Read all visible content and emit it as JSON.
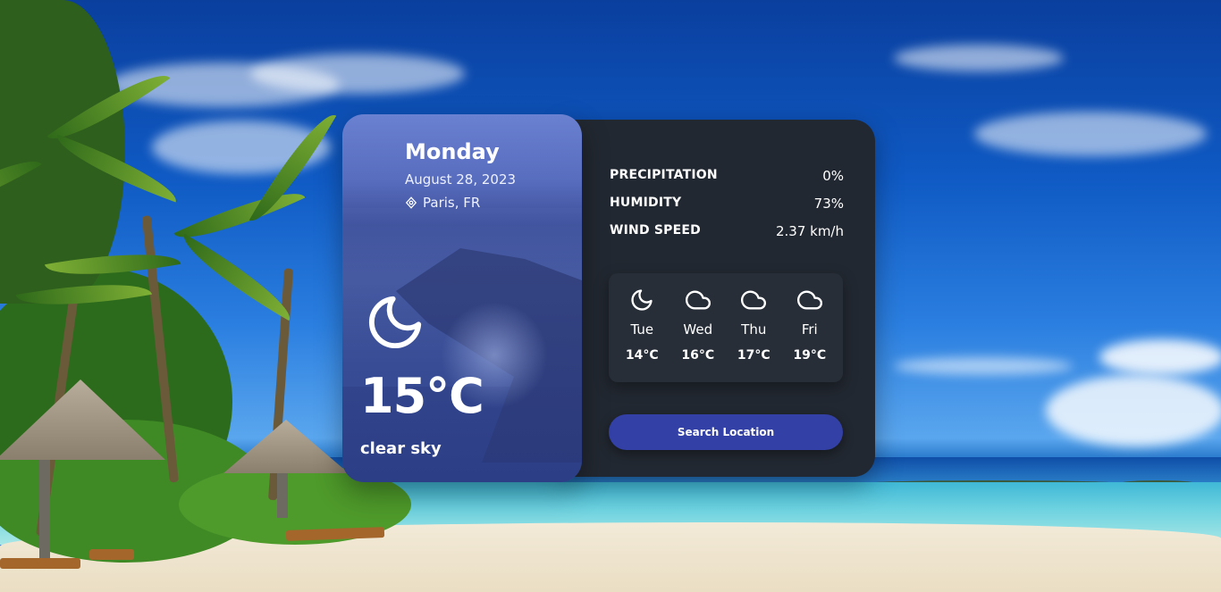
{
  "current": {
    "day": "Monday",
    "date": "August 28, 2023",
    "location": "Paris, FR",
    "icon": "moon-icon",
    "temperature": "15°C",
    "description": "clear sky"
  },
  "stats": [
    {
      "label": "PRECIPITATION",
      "value": "0%"
    },
    {
      "label": "HUMIDITY",
      "value": "73%"
    },
    {
      "label": "WIND SPEED",
      "value": "2.37 km/h"
    }
  ],
  "forecast": [
    {
      "day": "Tue",
      "temp": "14°C",
      "icon": "moon-icon"
    },
    {
      "day": "Wed",
      "temp": "16°C",
      "icon": "cloud-icon"
    },
    {
      "day": "Thu",
      "temp": "17°C",
      "icon": "cloud-icon"
    },
    {
      "day": "Fri",
      "temp": "19°C",
      "icon": "cloud-icon"
    }
  ],
  "search_button": "Search Location",
  "colors": {
    "panel": "#222831",
    "forecast_box": "#272e37",
    "button": "#3340a5",
    "text": "#ffffff"
  }
}
